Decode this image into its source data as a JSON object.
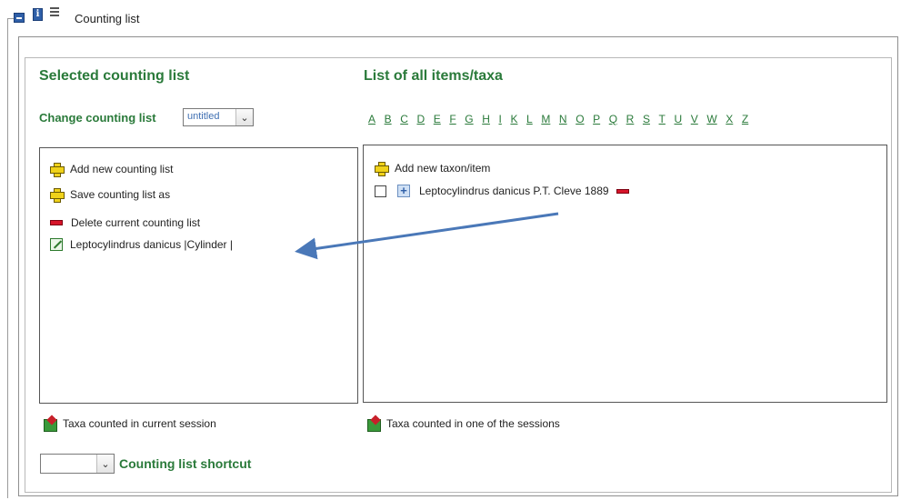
{
  "header": {
    "title": "Counting list"
  },
  "left": {
    "heading": "Selected counting list",
    "change_label": "Change counting list",
    "change_select_value": "untitled",
    "items": [
      {
        "label": "Add new counting list",
        "icon": "add-icon"
      },
      {
        "label": "Save counting list as",
        "icon": "add-icon"
      },
      {
        "label": "Delete current counting list",
        "icon": "delete-icon"
      },
      {
        "label": "Leptocylindrus danicus |Cylinder |",
        "icon": "edit-icon"
      }
    ],
    "legend": "Taxa counted in current session",
    "shortcut_value": "",
    "shortcut_label": "Counting list shortcut"
  },
  "right": {
    "heading": "List of all items/taxa",
    "alphabet": [
      "A",
      "B",
      "C",
      "D",
      "E",
      "F",
      "G",
      "H",
      "I",
      "K",
      "L",
      "M",
      "N",
      "O",
      "P",
      "Q",
      "R",
      "S",
      "T",
      "U",
      "V",
      "W",
      "X",
      "Z"
    ],
    "add_label": "Add new taxon/item",
    "taxon_label": "Leptocylindrus danicus P.T. Cleve 1889",
    "legend": "Taxa counted in one of the sessions"
  },
  "colors": {
    "heading_green": "#2a7a3a",
    "arrow_blue": "#4a78b8",
    "delete_red": "#d7142a",
    "add_yellow": "#f0d21a"
  }
}
